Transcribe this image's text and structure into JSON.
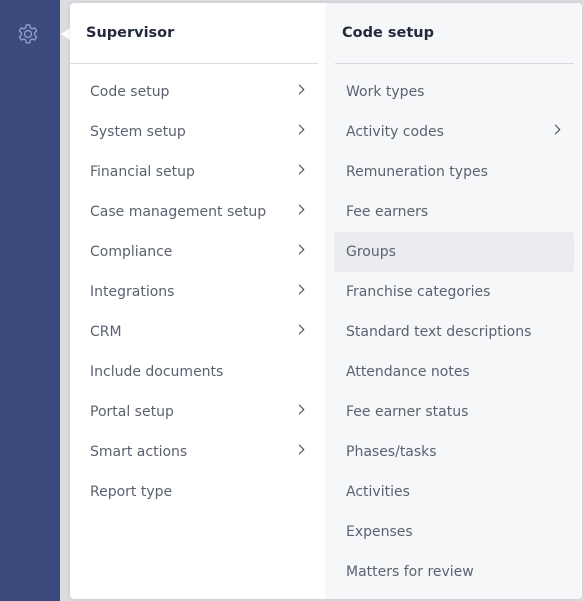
{
  "sidebar": {
    "settings_icon": "gear-icon"
  },
  "colors": {
    "sidebar_bg": "#3b4a7c",
    "menu_bg": "#ffffff",
    "submenu_bg": "#f6f7f8",
    "hover_bg": "#ebecef",
    "text": "#5b6170",
    "header_text": "#242a3e"
  },
  "menu": {
    "title": "Supervisor",
    "items": [
      {
        "label": "Code setup",
        "has_submenu": true
      },
      {
        "label": "System setup",
        "has_submenu": true
      },
      {
        "label": "Financial setup",
        "has_submenu": true
      },
      {
        "label": "Case management setup",
        "has_submenu": true
      },
      {
        "label": "Compliance",
        "has_submenu": true
      },
      {
        "label": "Integrations",
        "has_submenu": true
      },
      {
        "label": "CRM",
        "has_submenu": true
      },
      {
        "label": "Include documents",
        "has_submenu": false
      },
      {
        "label": "Portal setup",
        "has_submenu": true
      },
      {
        "label": "Smart actions",
        "has_submenu": true
      },
      {
        "label": "Report type",
        "has_submenu": false
      }
    ]
  },
  "submenu": {
    "title": "Code setup",
    "hovered_item": "Groups",
    "items": [
      {
        "label": "Work types",
        "has_submenu": false
      },
      {
        "label": "Activity codes",
        "has_submenu": true
      },
      {
        "label": "Remuneration types",
        "has_submenu": false
      },
      {
        "label": "Fee earners",
        "has_submenu": false
      },
      {
        "label": "Groups",
        "has_submenu": false
      },
      {
        "label": "Franchise categories",
        "has_submenu": false
      },
      {
        "label": "Standard text descriptions",
        "has_submenu": false
      },
      {
        "label": "Attendance notes",
        "has_submenu": false
      },
      {
        "label": "Fee earner status",
        "has_submenu": false
      },
      {
        "label": "Phases/tasks",
        "has_submenu": false
      },
      {
        "label": "Activities",
        "has_submenu": false
      },
      {
        "label": "Expenses",
        "has_submenu": false
      },
      {
        "label": "Matters for review",
        "has_submenu": false
      }
    ]
  }
}
